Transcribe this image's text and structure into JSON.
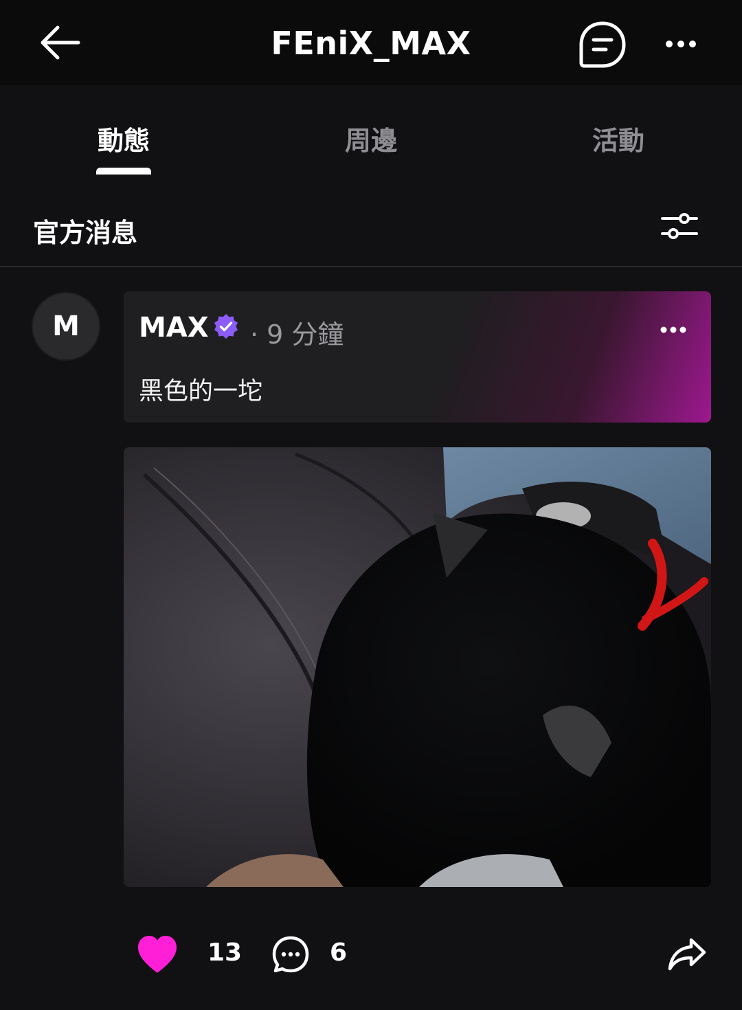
{
  "header": {
    "title": "FEniX_MAX",
    "back_icon": "arrow-left-icon",
    "chat_icon": "chat-bubble-icon",
    "more_icon": "more-horizontal-icon"
  },
  "tabs": [
    {
      "label": "動態",
      "active": true
    },
    {
      "label": "周邊",
      "active": false
    },
    {
      "label": "活動",
      "active": false
    }
  ],
  "section": {
    "title": "官方消息",
    "filter_icon": "sliders-icon"
  },
  "post": {
    "avatar_initial": "M",
    "author": "MAX",
    "verified": true,
    "time": "· 9 分鐘",
    "text": "黑色的一坨",
    "image_description_icon": "photo",
    "likes": "13",
    "comments": "6"
  },
  "colors": {
    "background": "#111012",
    "accent_like": "#ff1fd6",
    "verified": "#8b5cf6",
    "card_gradient_end": "#9d188f"
  }
}
